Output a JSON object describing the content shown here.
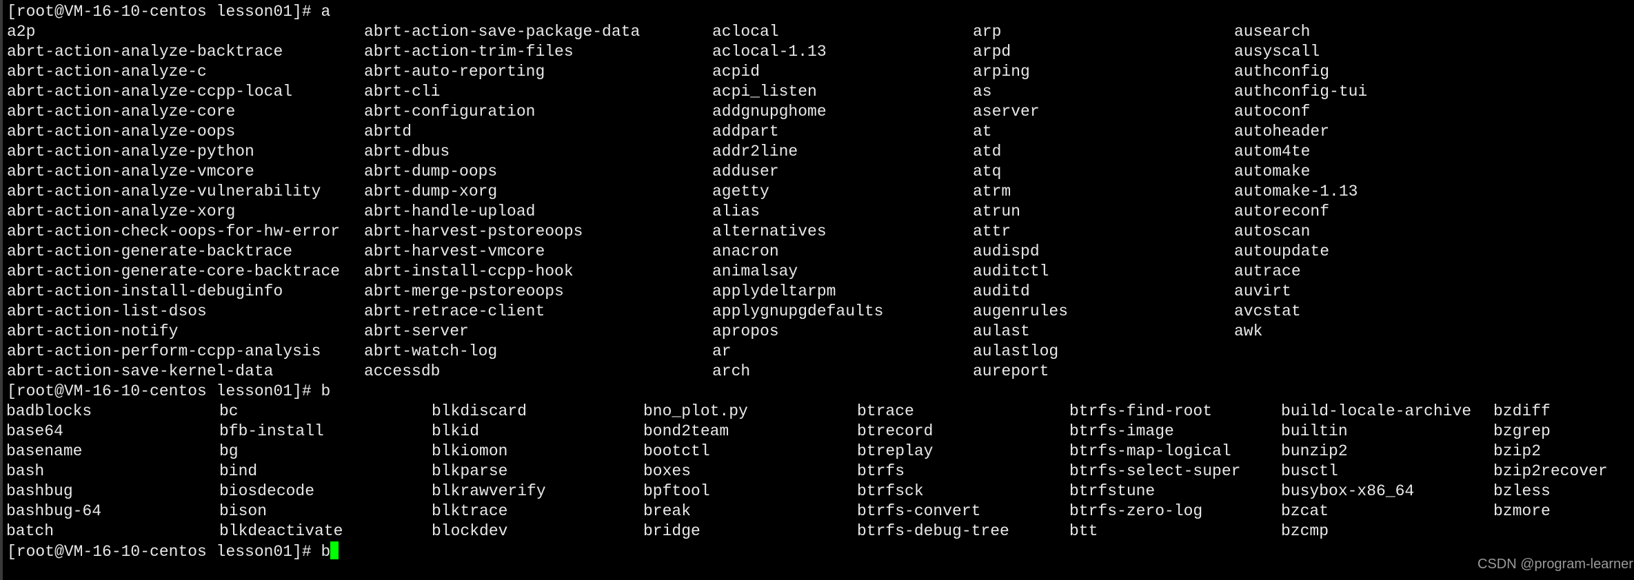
{
  "terminal": {
    "prompt": "[root@VM-16-10-centos lesson01]# ",
    "commands": [
      "a",
      "b",
      "b"
    ],
    "cursor_color": "#00ff00",
    "a_columns": [
      [
        "a2p",
        "abrt-action-analyze-backtrace",
        "abrt-action-analyze-c",
        "abrt-action-analyze-ccpp-local",
        "abrt-action-analyze-core",
        "abrt-action-analyze-oops",
        "abrt-action-analyze-python",
        "abrt-action-analyze-vmcore",
        "abrt-action-analyze-vulnerability",
        "abrt-action-analyze-xorg",
        "abrt-action-check-oops-for-hw-error",
        "abrt-action-generate-backtrace",
        "abrt-action-generate-core-backtrace",
        "abrt-action-install-debuginfo",
        "abrt-action-list-dsos",
        "abrt-action-notify",
        "abrt-action-perform-ccpp-analysis",
        "abrt-action-save-kernel-data"
      ],
      [
        "abrt-action-save-package-data",
        "abrt-action-trim-files",
        "abrt-auto-reporting",
        "abrt-cli",
        "abrt-configuration",
        "abrtd",
        "abrt-dbus",
        "abrt-dump-oops",
        "abrt-dump-xorg",
        "abrt-handle-upload",
        "abrt-harvest-pstoreoops",
        "abrt-harvest-vmcore",
        "abrt-install-ccpp-hook",
        "abrt-merge-pstoreoops",
        "abrt-retrace-client",
        "abrt-server",
        "abrt-watch-log",
        "accessdb"
      ],
      [
        "aclocal",
        "aclocal-1.13",
        "acpid",
        "acpi_listen",
        "addgnupghome",
        "addpart",
        "addr2line",
        "adduser",
        "agetty",
        "alias",
        "alternatives",
        "anacron",
        "animalsay",
        "applydeltarpm",
        "applygnupgdefaults",
        "apropos",
        "ar",
        "arch"
      ],
      [
        "arp",
        "arpd",
        "arping",
        "as",
        "aserver",
        "at",
        "atd",
        "atq",
        "atrm",
        "atrun",
        "attr",
        "audispd",
        "auditctl",
        "auditd",
        "augenrules",
        "aulast",
        "aulastlog",
        "aureport"
      ],
      [
        "ausearch",
        "ausyscall",
        "authconfig",
        "authconfig-tui",
        "autoconf",
        "autoheader",
        "autom4te",
        "automake",
        "automake-1.13",
        "autoreconf",
        "autoscan",
        "autoupdate",
        "autrace",
        "auvirt",
        "avcstat",
        "awk"
      ]
    ],
    "b_columns": [
      [
        "badblocks",
        "base64",
        "basename",
        "bash",
        "bashbug",
        "bashbug-64",
        "batch"
      ],
      [
        "bc",
        "bfb-install",
        "bg",
        "bind",
        "biosdecode",
        "bison",
        "blkdeactivate"
      ],
      [
        "blkdiscard",
        "blkid",
        "blkiomon",
        "blkparse",
        "blkrawverify",
        "blktrace",
        "blockdev"
      ],
      [
        "bno_plot.py",
        "bond2team",
        "bootctl",
        "boxes",
        "bpftool",
        "break",
        "bridge"
      ],
      [
        "btrace",
        "btrecord",
        "btreplay",
        "btrfs",
        "btrfsck",
        "btrfs-convert",
        "btrfs-debug-tree"
      ],
      [
        "btrfs-find-root",
        "btrfs-image",
        "btrfs-map-logical",
        "btrfs-select-super",
        "btrfstune",
        "btrfs-zero-log",
        "btt"
      ],
      [
        "build-locale-archive",
        "builtin",
        "bunzip2",
        "busctl",
        "busybox-x86_64",
        "bzcat",
        "bzcmp"
      ],
      [
        "bzdiff",
        "bzgrep",
        "bzip2",
        "bzip2recover",
        "bzless",
        "bzmore"
      ]
    ]
  },
  "watermark": "CSDN @program-learner"
}
